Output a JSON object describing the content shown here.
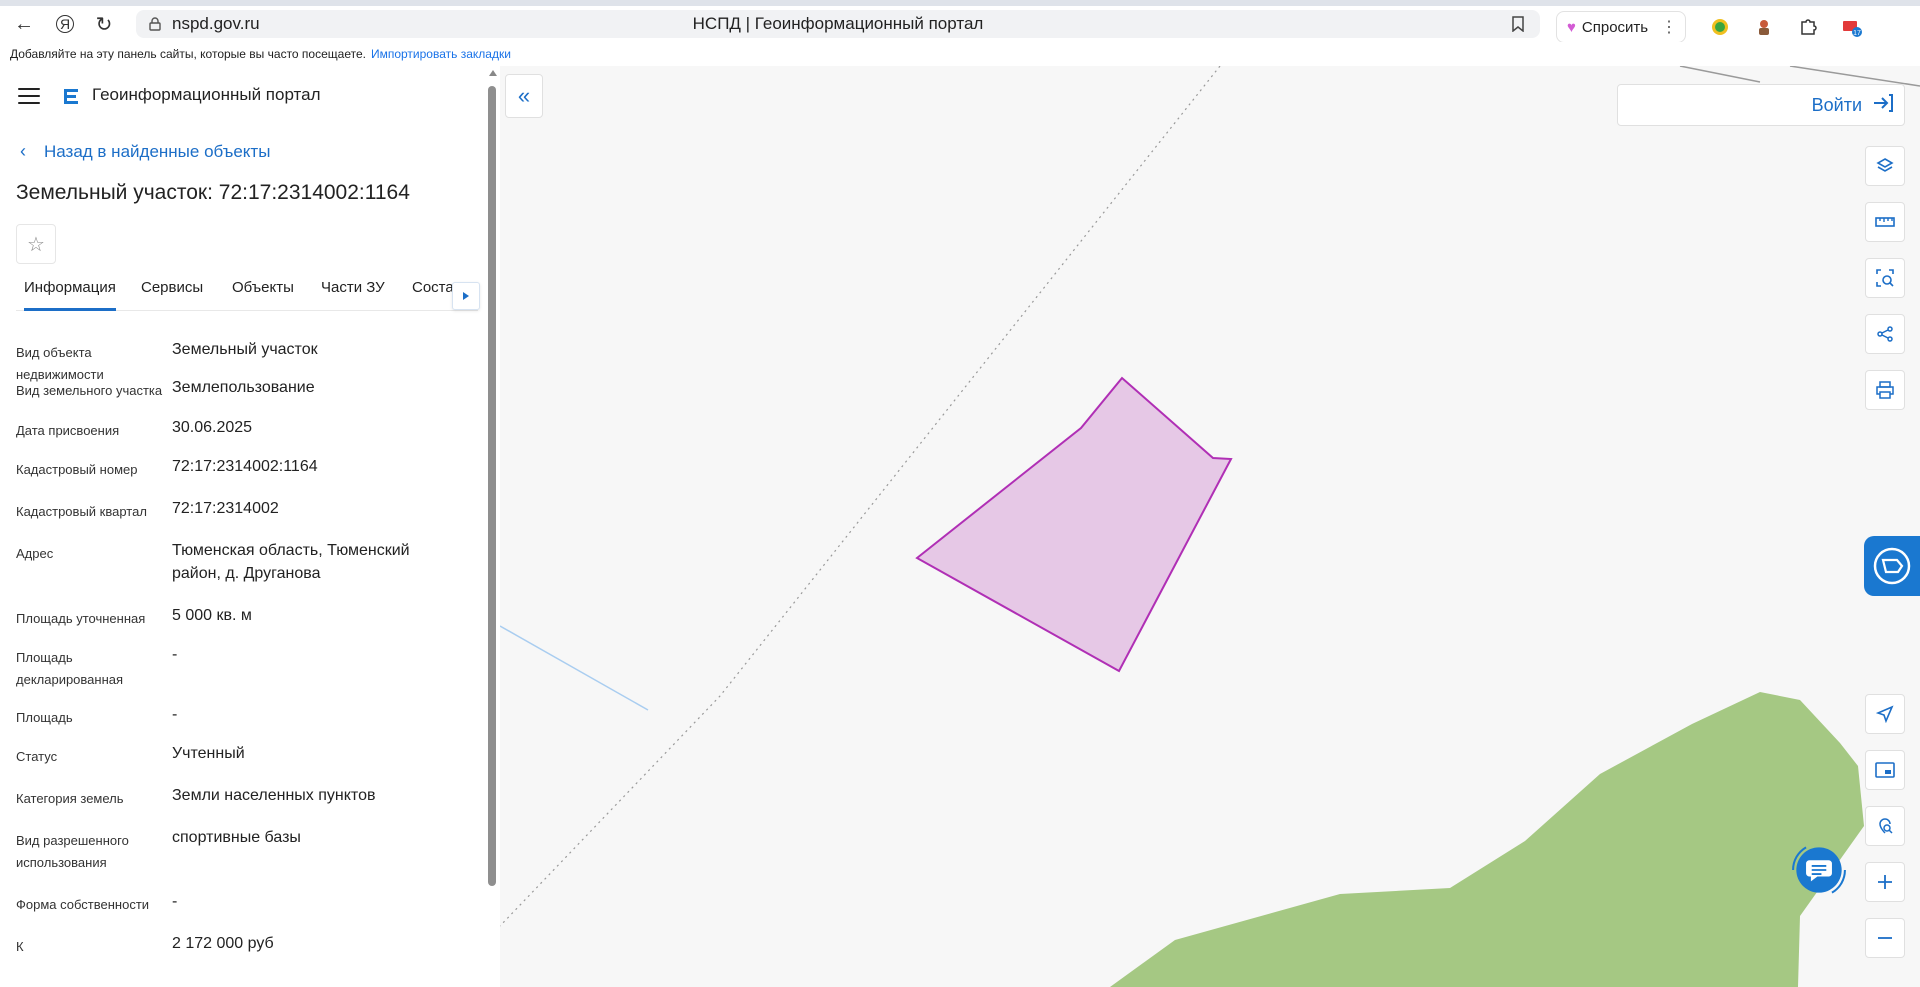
{
  "browser": {
    "url": "nspd.gov.ru",
    "tab_title": "НСПД | Геоинформационный портал",
    "ask_label": "Спросить",
    "ext_badge": "17",
    "bookmarks_hint": "Добавляйте на эту панель сайты, которые вы часто посещаете.",
    "import_bookmarks": "Импортировать закладки"
  },
  "panel": {
    "portal_title": "Геоинформационный портал",
    "back_label": "Назад в найденные объекты",
    "object_title": "Земельный участок: 72:17:2314002:1164",
    "tabs": [
      {
        "label": "Информация",
        "active": true
      },
      {
        "label": "Сервисы",
        "active": false
      },
      {
        "label": "Объекты",
        "active": false
      },
      {
        "label": "Части ЗУ",
        "active": false
      },
      {
        "label": "Соста",
        "active": false
      }
    ],
    "info": [
      {
        "label": "Вид объекта недвижимости",
        "value": "Земельный участок"
      },
      {
        "label": "Вид земельного участка",
        "value": "Землепользование"
      },
      {
        "label": "Дата присвоения",
        "value": "30.06.2025"
      },
      {
        "label": "Кадастровый номер",
        "value": "72:17:2314002:1164"
      },
      {
        "label": "Кадастровый квартал",
        "value": "72:17:2314002"
      },
      {
        "label": "Адрес",
        "value": "Тюменская область, Тюменский район, д. Друганова"
      },
      {
        "label": "Площадь уточненная",
        "value": "5 000 кв. м"
      },
      {
        "label": "Площадь декларированная",
        "value": "-"
      },
      {
        "label": "Площадь",
        "value": "-"
      },
      {
        "label": "Статус",
        "value": "Учтенный"
      },
      {
        "label": "Категория земель",
        "value": "Земли населенных пунктов"
      },
      {
        "label": "Вид разрешенного использования",
        "value": "спортивные базы"
      },
      {
        "label": "Форма собственности",
        "value": "-"
      },
      {
        "label": "К",
        "value": "2 172 000 руб"
      }
    ]
  },
  "map": {
    "login_label": "Войти",
    "parcel_fill": "#e6c8e6",
    "parcel_stroke": "#b02fb5",
    "green_area": "#a5c883",
    "accent": "#1c6ec7"
  }
}
